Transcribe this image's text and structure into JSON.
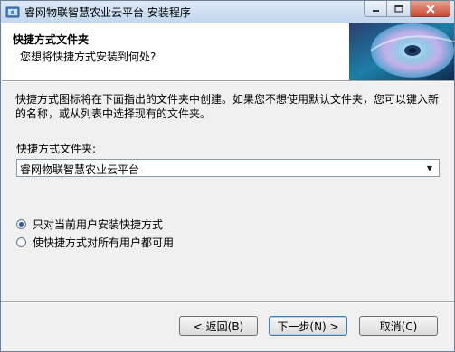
{
  "window": {
    "title": "睿网物联智慧农业云平台 安装程序",
    "controls": {
      "minimize_icon": "minimize-icon",
      "maximize_icon": "maximize-icon",
      "close_icon": "close-icon"
    }
  },
  "header": {
    "title": "快捷方式文件夹",
    "subtitle": "您想将快捷方式安装到何处?"
  },
  "main": {
    "description": "快捷方式图标将在下面指出的文件夹中创建。如果您不想使用默认文件夹，您可以键入新的名称，或从列表中选择现有的文件夹。",
    "folder_label": "快捷方式文件夹:",
    "folder_value": "睿网物联智慧农业云平台",
    "radio_current_user": "只对当前用户安装快捷方式",
    "radio_all_users": "使快捷方式对所有用户都可用",
    "selected_option": "current_user"
  },
  "buttons": {
    "back": "< 返回(B)",
    "next": "下一步(N) >",
    "cancel": "取消(C)"
  },
  "colors": {
    "accent": "#2c5aa8",
    "titlebar": "#c4d7ee"
  }
}
